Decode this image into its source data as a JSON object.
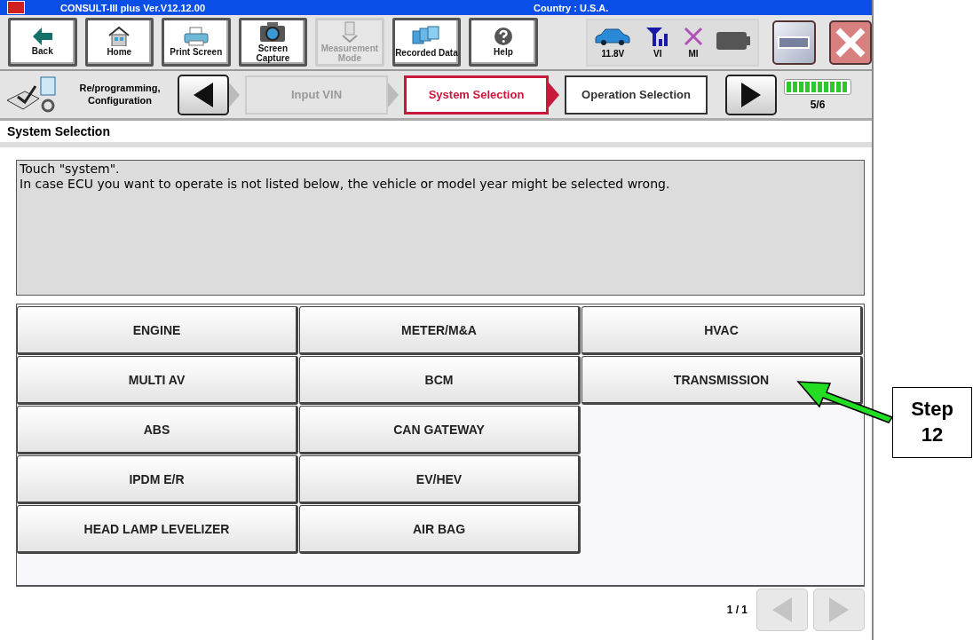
{
  "title_bar": {
    "app": "CONSULT-III plus  Ver.V12.12.00",
    "country": "Country : U.S.A."
  },
  "toolbar": [
    {
      "label": "Back",
      "kind": "back",
      "disabled": false
    },
    {
      "label": "Home",
      "kind": "home",
      "disabled": false
    },
    {
      "label": "Print Screen",
      "kind": "print",
      "disabled": false
    },
    {
      "label": "Screen Capture",
      "kind": "camera",
      "disabled": false
    },
    {
      "label": "Measurement Mode",
      "kind": "meter",
      "disabled": true
    },
    {
      "label": "Recorded Data",
      "kind": "folders",
      "disabled": false
    },
    {
      "label": "Help",
      "kind": "help",
      "disabled": false
    }
  ],
  "status": [
    {
      "label": "11.8V",
      "kind": "car"
    },
    {
      "label": "VI",
      "kind": "signal"
    },
    {
      "label": "MI",
      "kind": "cross"
    },
    {
      "kind": "battery"
    }
  ],
  "breadcrumb": {
    "title": "Re/programming, Configuration",
    "steps": [
      {
        "label": "Input VIN",
        "selected": false,
        "disabled": true
      },
      {
        "label": "System Selection",
        "selected": true,
        "disabled": false
      },
      {
        "label": "Operation Selection",
        "selected": false,
        "disabled": false
      }
    ],
    "progress": {
      "level": 1,
      "label": "5/6"
    }
  },
  "section_title": "System Selection",
  "message": [
    "Touch  \"system\".",
    "In case ECU you want to operate is not listed below, the vehicle or model year might be selected wrong."
  ],
  "systems": [
    [
      "ENGINE",
      "METER/M&A",
      "HVAC"
    ],
    [
      "MULTI AV",
      "BCM",
      "TRANSMISSION"
    ],
    [
      "ABS",
      "CAN GATEWAY"
    ],
    [
      "IPDM E/R",
      "EV/HEV"
    ],
    [
      "HEAD LAMP LEVELIZER",
      "AIR BAG"
    ]
  ],
  "pager": {
    "label": "1 / 1"
  },
  "callout": {
    "text": "Step 12"
  }
}
